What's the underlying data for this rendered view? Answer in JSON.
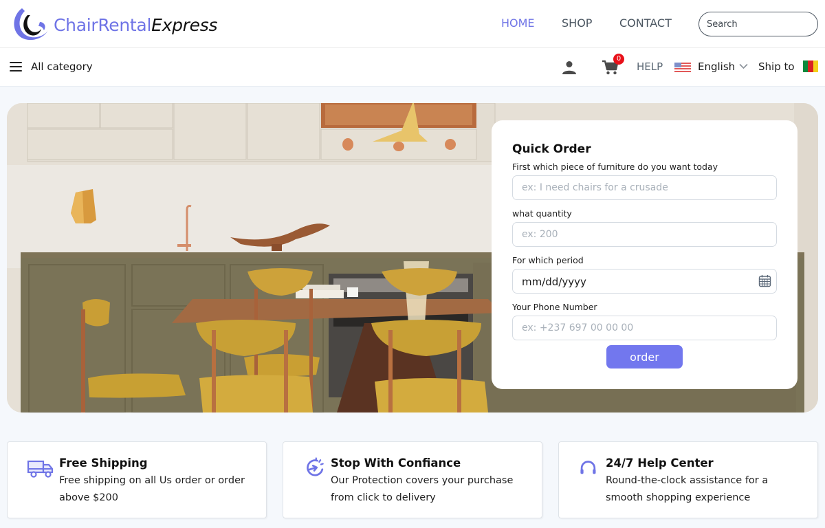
{
  "brand": {
    "name_part1": "ChairRental",
    "name_part2": "Express",
    "accent_color": "#6f74e6"
  },
  "nav": {
    "items": [
      {
        "label": "HOME",
        "active": true
      },
      {
        "label": "SHOP",
        "active": false
      },
      {
        "label": "CONTACT",
        "active": false
      }
    ],
    "search_placeholder": "Search"
  },
  "subbar": {
    "all_category": "All category",
    "cart_count": "0",
    "help": "HELP",
    "language": "English",
    "ship_to": "Ship to"
  },
  "quick_order": {
    "title": "Quick Order",
    "fields": [
      {
        "label": "First which piece of furniture do you want today",
        "placeholder": "ex: I need chairs for a crusade"
      },
      {
        "label": "what quantity",
        "placeholder": "ex: 200"
      },
      {
        "label": "For which period",
        "value": "mm/dd/yyyy"
      },
      {
        "label": "Your Phone Number",
        "placeholder": "ex: +237 697 00 00 00"
      }
    ],
    "submit_label": "order",
    "button_color": "#7277ee"
  },
  "features": [
    {
      "icon": "truck-icon",
      "title": "Free Shipping",
      "text": "Free shipping on all Us order or order above $200"
    },
    {
      "icon": "refresh-protection-icon",
      "title": "Stop With Confiance",
      "text": "Our Protection covers your purchase from click to delivery"
    },
    {
      "icon": "headphones-icon",
      "title": "24/7 Help Center",
      "text": "Round-the-clock assistance for a smooth shopping experience"
    }
  ]
}
